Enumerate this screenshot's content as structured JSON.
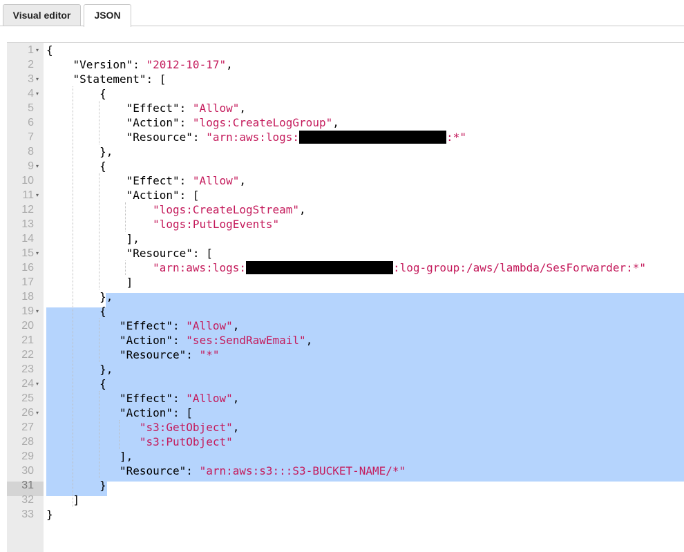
{
  "tabs": [
    {
      "label": "Visual editor",
      "active": false
    },
    {
      "label": "JSON",
      "active": true
    }
  ],
  "colors": {
    "string": "#c41a5b",
    "selection": "#b5d4fd",
    "gutter": "#ebebeb"
  },
  "editor": {
    "lines": [
      "{",
      "    \"Version\": \"2012-10-17\",",
      "    \"Statement\": [",
      "        {",
      "            \"Effect\": \"Allow\",",
      "            \"Action\": \"logs:CreateLogGroup\",",
      "            \"Resource\": \"arn:aws:logs:[REDACTED]:*\"",
      "        },",
      "        {",
      "            \"Effect\": \"Allow\",",
      "            \"Action\": [",
      "                \"logs:CreateLogStream\",",
      "                \"logs:PutLogEvents\"",
      "            ],",
      "            \"Resource\": [",
      "                \"arn:aws:logs:[REDACTED]:log-group:/aws/lambda/SesForwarder:*\"",
      "            ]",
      "        },",
      "        {",
      "           \"Effect\": \"Allow\",",
      "           \"Action\": \"ses:SendRawEmail\",",
      "           \"Resource\": \"*\"",
      "        },",
      "        {",
      "           \"Effect\": \"Allow\",",
      "           \"Action\": [",
      "              \"s3:GetObject\",",
      "              \"s3:PutObject\"",
      "           ],",
      "           \"Resource\": \"arn:aws:s3:::S3-BUCKET-NAME/*\"",
      "        }",
      "    ]",
      "}"
    ],
    "fold_lines": [
      1,
      3,
      4,
      9,
      11,
      15,
      19,
      24,
      26
    ],
    "active_line": 31,
    "selection": {
      "from_line": 18,
      "to_line": 31
    }
  }
}
